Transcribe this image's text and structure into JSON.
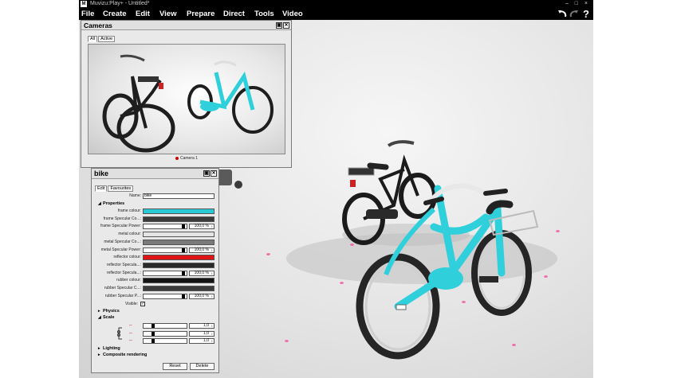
{
  "window": {
    "title": "Muvizu:Play+ - Untitled*",
    "logo": "M",
    "buttons": "– □ ×"
  },
  "menu": [
    "File",
    "Create",
    "Edit",
    "View",
    "Prepare",
    "Direct",
    "Tools",
    "Video"
  ],
  "toolbar": {
    "undo_icon": "undo-icon",
    "redo_icon": "redo-icon",
    "help": "?"
  },
  "cameras_panel": {
    "title": "Cameras",
    "tabs": [
      "All",
      "Active"
    ],
    "active_tab": "All",
    "camera_label": "Camera 1"
  },
  "props_panel": {
    "title": "bike",
    "tabs": [
      "Edit",
      "Favourites"
    ],
    "active_tab": "Edit",
    "name_label": "Name:",
    "name_value": "bike",
    "section_properties": "Properties",
    "rows": [
      {
        "label": "frame colour:",
        "type": "color",
        "color": "#29c9d6"
      },
      {
        "label": "frame Specular Co...:",
        "type": "color",
        "color": "#3a3a3a"
      },
      {
        "label": "frame Specular Power:",
        "type": "slider",
        "value": "100,0 %",
        "level": 1.0
      },
      {
        "label": "metal colour:",
        "type": "color",
        "color": "#e4e4e4"
      },
      {
        "label": "metal Specular Co...:",
        "type": "color",
        "color": "#7a7a7a"
      },
      {
        "label": "metal Specular Power:",
        "type": "slider",
        "value": "100,0 %",
        "level": 1.0
      },
      {
        "label": "reflector colour:",
        "type": "color",
        "color": "#e01414"
      },
      {
        "label": "reflector Specula...:",
        "type": "color",
        "color": "#2a2a2a"
      },
      {
        "label": "reflector Specula...:",
        "type": "slider",
        "value": "100,0 %",
        "level": 1.0
      },
      {
        "label": "rubber colour:",
        "type": "color",
        "color": "#141414"
      },
      {
        "label": "rubber Specular C...:",
        "type": "color",
        "color": "#3c3c3c"
      },
      {
        "label": "rubber Specular P...:",
        "type": "slider",
        "value": "100,0 %",
        "level": 1.0
      }
    ],
    "visible_label": "Visible:",
    "visible_checked": "✓",
    "section_physics": "Physics",
    "section_scale": "Scale",
    "scale_rows": [
      {
        "axis": "x",
        "value": "1,0"
      },
      {
        "axis": "y",
        "value": "1,0"
      },
      {
        "axis": "z",
        "value": "1,0"
      }
    ],
    "section_lighting": "Lighting",
    "section_composite": "Composite rendering",
    "reset_label": "Reset",
    "delete_label": "Delete"
  }
}
